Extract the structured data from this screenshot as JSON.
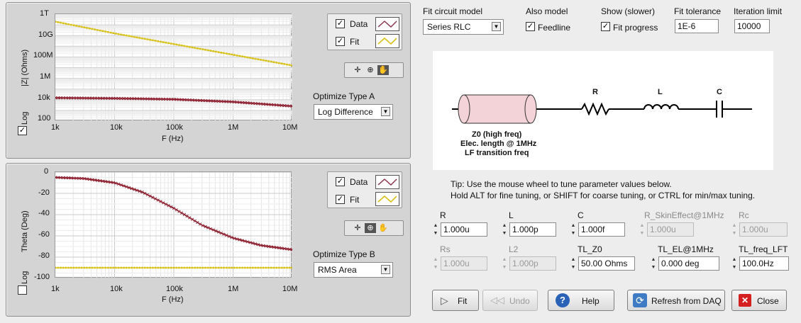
{
  "top_chart": {
    "legend": {
      "data_label": "Data",
      "fit_label": "Fit",
      "data_checked": true,
      "fit_checked": true
    },
    "ylabel": "|Z| (Ohms)",
    "xlabel": "F (Hz)",
    "log_label": "Log",
    "log_checked": true,
    "optimize_label": "Optimize Type A",
    "optimize_value": "Log Difference",
    "x_ticks": [
      "1k",
      "10k",
      "100k",
      "1M",
      "10M"
    ],
    "y_ticks": [
      "1T",
      "10G",
      "100M",
      "1M",
      "10k",
      "100"
    ]
  },
  "bottom_chart": {
    "legend": {
      "data_label": "Data",
      "fit_label": "Fit",
      "data_checked": true,
      "fit_checked": true
    },
    "ylabel": "Theta (Deg)",
    "xlabel": "F (Hz)",
    "log_label": "Log",
    "log_checked": false,
    "optimize_label": "Optimize Type B",
    "optimize_value": "RMS Area",
    "x_ticks": [
      "1k",
      "10k",
      "100k",
      "1M",
      "10M"
    ],
    "y_ticks": [
      "0",
      "-20",
      "-40",
      "-60",
      "-80",
      "-100"
    ]
  },
  "chart_data": [
    {
      "type": "line",
      "xlabel": "F (Hz)",
      "ylabel": "|Z| (Ohms)",
      "xscale": "log",
      "yscale": "log",
      "xlim": [
        1000,
        10000000
      ],
      "ylim": [
        100,
        1000000000000
      ],
      "grid": true,
      "legend_position": "right, outside",
      "series": [
        {
          "name": "Data",
          "color": "#8b1a2b",
          "x": [
            1000,
            10000,
            100000,
            1000000,
            10000000
          ],
          "y": [
            15000,
            13500,
            11000,
            6300,
            2500
          ]
        },
        {
          "name": "Fit",
          "color": "#d8c21e",
          "x": [
            1000,
            10000,
            100000,
            1000000,
            10000000
          ],
          "y": [
            200000000000,
            16000000000,
            1600000000,
            160000000,
            16000000
          ]
        }
      ]
    },
    {
      "type": "line",
      "xlabel": "F (Hz)",
      "ylabel": "Theta (Deg)",
      "xscale": "log",
      "yscale": "linear",
      "xlim": [
        1000,
        10000000
      ],
      "ylim": [
        -100,
        0
      ],
      "grid": true,
      "legend_position": "right, outside",
      "series": [
        {
          "name": "Data",
          "color": "#8b1a2b",
          "x": [
            1000,
            3000,
            10000,
            30000,
            100000,
            300000,
            1000000,
            3000000,
            10000000
          ],
          "y": [
            -5,
            -6,
            -10,
            -19,
            -34,
            -50,
            -62,
            -69,
            -73
          ]
        },
        {
          "name": "Fit",
          "color": "#d8c21e",
          "x": [
            1000,
            10000000
          ],
          "y": [
            -90,
            -90
          ]
        }
      ]
    }
  ],
  "model": {
    "fit_model_label": "Fit circuit model",
    "fit_model_value": "Series RLC",
    "also_model_label": "Also model",
    "feedline_label": "Feedline",
    "feedline_checked": true,
    "show_label": "Show (slower)",
    "fit_progress_label": "Fit progress",
    "fit_progress_checked": true,
    "tolerance_label": "Fit tolerance",
    "tolerance_value": "1E-6",
    "iteration_label": "Iteration limit",
    "iteration_value": "10000"
  },
  "diagram": {
    "r_label": "R",
    "l_label": "L",
    "c_label": "C",
    "tl_line1": "Z0 (high freq)",
    "tl_line2": "Elec. length @ 1MHz",
    "tl_line3": "LF transition freq",
    "tl_color": "#f3d3d7"
  },
  "tip": {
    "line1": "Tip: Use the mouse wheel to tune parameter values below.",
    "line2": "Hold ALT for fine tuning, or SHIFT for coarse tuning, or CTRL for min/max tuning."
  },
  "params": {
    "r": {
      "label": "R",
      "value": "1.000u"
    },
    "l": {
      "label": "L",
      "value": "1.000p"
    },
    "c": {
      "label": "C",
      "value": "1.000f"
    },
    "rskin": {
      "label": "R_SkinEffect@1MHz",
      "value": "1.000u"
    },
    "rc": {
      "label": "Rc",
      "value": "1.000u"
    },
    "rs": {
      "label": "Rs",
      "value": "1.000u"
    },
    "l2": {
      "label": "L2",
      "value": "1.000p"
    },
    "tlz0": {
      "label": "TL_Z0",
      "value": "50.00 Ohms"
    },
    "tlel": {
      "label": "TL_EL@1MHz",
      "value": "0.000 deg"
    },
    "tlfreq": {
      "label": "TL_freq_LFT",
      "value": "100.0Hz"
    }
  },
  "buttons": {
    "fit": "Fit",
    "undo": "Undo",
    "help": "Help",
    "refresh": "Refresh from DAQ",
    "close": "Close"
  },
  "colors": {
    "data": "#8b1a2b",
    "fit": "#d8c21e",
    "close_icon": "#d42020",
    "help_icon": "#2a62b8"
  }
}
